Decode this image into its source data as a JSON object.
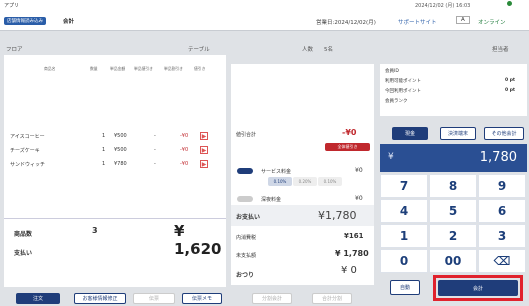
{
  "topbar": {
    "app": "アプリ",
    "status": "2024/12/02 (月) 16:03"
  },
  "header": {
    "badge": "店舗情報読み込み",
    "title": "会計",
    "date": "営業日:2024/12/02(月)",
    "support": "サポートサイト",
    "mode": "オンライン",
    "lang": "A"
  },
  "info": {
    "floor": "フロア",
    "table": "テーブル",
    "people_label": "人数",
    "people": "5名",
    "reporter": "担当者"
  },
  "table": {
    "headers": [
      "商品名",
      "数量",
      "単品金額",
      "単品値引き",
      "単品割引き",
      "値引き"
    ],
    "rows": [
      {
        "name": "アイスコーヒー",
        "qty": "1",
        "price": "¥500",
        "d1": "-",
        "d2": "-¥0"
      },
      {
        "name": "チーズケーキ",
        "qty": "1",
        "price": "¥500",
        "d1": "-",
        "d2": "-¥0"
      },
      {
        "name": "サンドウィッチ",
        "qty": "1",
        "price": "¥780",
        "d1": "-",
        "d2": "-¥0"
      }
    ]
  },
  "summary": {
    "count_label": "商品数",
    "count": "3",
    "total": "¥ 1,620",
    "pay_label": "支払い"
  },
  "bottom_buttons": [
    "注文",
    "お客様情報修正",
    "伝票",
    "伝票メモ"
  ],
  "middle": {
    "discount_label": "値引合計",
    "discount": "-¥0",
    "all_discount": "全体値引き",
    "service_label": "サービス料金",
    "service_val": "¥0",
    "rates": [
      "0.10%",
      "0.20%",
      "0.10%"
    ],
    "tax_label": "深夜料金",
    "tax_val": "¥0",
    "pay_label": "お支払い",
    "pay": "¥1,780",
    "inner_label": "内消費税",
    "inner": "¥161",
    "due_label": "未支払額",
    "due": "¥ 1,780",
    "change_label": "おつり",
    "change": "¥ 0",
    "btn1": "分割会計",
    "btn2": "合計分割"
  },
  "customer": {
    "title": "会員ID",
    "points1_label": "利用可能ポイント",
    "points1": "0 pt",
    "points2_label": "今回利用ポイント",
    "points2": "0 pt",
    "rank": "会員ランク"
  },
  "pay_tabs": [
    "現金",
    "決済端末",
    "その他会計"
  ],
  "display": "1,780",
  "yen": "¥",
  "keys": [
    "7",
    "8",
    "9",
    "4",
    "5",
    "6",
    "1",
    "2",
    "3",
    "0",
    "00",
    "⌫"
  ],
  "actions": {
    "auto": "自動",
    "checkout": "会計"
  },
  "highlight": "#e0222d"
}
